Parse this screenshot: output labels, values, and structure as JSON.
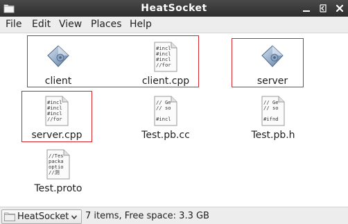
{
  "window": {
    "title": "HeatSocket"
  },
  "menu": {
    "file": "File",
    "edit": "Edit",
    "view": "View",
    "places": "Places",
    "help": "Help"
  },
  "files": [
    {
      "name": "client",
      "type": "executable",
      "icon": "executable-icon"
    },
    {
      "name": "client.cpp",
      "type": "source",
      "icon": "text-file-icon",
      "preview": [
        "#incl",
        "#incl",
        "#incl",
        "//for"
      ]
    },
    {
      "name": "server",
      "type": "executable",
      "icon": "executable-icon"
    },
    {
      "name": "server.cpp",
      "type": "source",
      "icon": "text-file-icon",
      "preview": [
        "#incl",
        "#incl",
        "#incl",
        "//for"
      ]
    },
    {
      "name": "Test.pb.cc",
      "type": "source",
      "icon": "text-file-icon",
      "preview": [
        "// Ge",
        "// so",
        "",
        "#incl"
      ]
    },
    {
      "name": "Test.pb.h",
      "type": "source",
      "icon": "text-file-icon",
      "preview": [
        "// Ge",
        "// so",
        "",
        "#ifnd"
      ]
    },
    {
      "name": "Test.proto",
      "type": "source",
      "icon": "text-file-icon",
      "preview": [
        "//Tes",
        "packa",
        "optio",
        "//测"
      ]
    }
  ],
  "status": {
    "location": "HeatSocket",
    "summary": "7 items, Free space: 3.3 GB"
  },
  "colors": {
    "titlebar": "#3a3a3a",
    "highlight_box": "#d8232a",
    "menubar": "#ededed"
  }
}
